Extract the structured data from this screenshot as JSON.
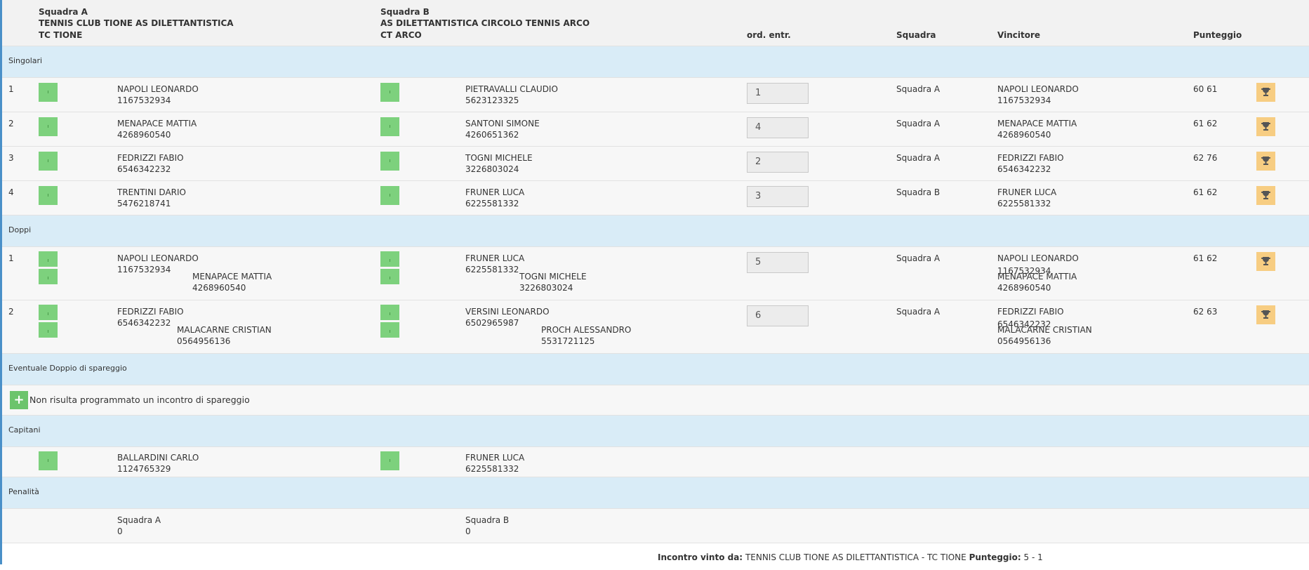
{
  "header": {
    "team_a_label": "Squadra A",
    "team_a_name": "TENNIS CLUB TIONE AS DILETTANTISTICA",
    "team_a_short": "TC TIONE",
    "team_b_label": "Squadra B",
    "team_b_name": "AS DILETTANTISTICA CIRCOLO TENNIS ARCO",
    "team_b_short": "CT ARCO",
    "col_order": "ord. entr.",
    "col_team": "Squadra",
    "col_winner": "Vincitore",
    "col_score": "Punteggio"
  },
  "sections": {
    "singles": "Singolari",
    "doubles": "Doppi",
    "tiebreak": "Eventuale Doppio di spareggio",
    "captains": "Capitani",
    "penalties": "Penalità"
  },
  "singles": [
    {
      "num": "1",
      "a_name": "NAPOLI LEONARDO",
      "a_id": "1167532934",
      "b_name": "PIETRAVALLI CLAUDIO",
      "b_id": "5623123325",
      "order": "1",
      "team": "Squadra A",
      "w_name": "NAPOLI LEONARDO",
      "w_id": "1167532934",
      "score": "60 61"
    },
    {
      "num": "2",
      "a_name": "MENAPACE MATTIA",
      "a_id": "4268960540",
      "b_name": "SANTONI SIMONE",
      "b_id": "4260651362",
      "order": "4",
      "team": "Squadra A",
      "w_name": "MENAPACE MATTIA",
      "w_id": "4268960540",
      "score": "61 62"
    },
    {
      "num": "3",
      "a_name": "FEDRIZZI FABIO",
      "a_id": "6546342232",
      "b_name": "TOGNI MICHELE",
      "b_id": "3226803024",
      "order": "2",
      "team": "Squadra A",
      "w_name": "FEDRIZZI FABIO",
      "w_id": "6546342232",
      "score": "62 76"
    },
    {
      "num": "4",
      "a_name": "TRENTINI DARIO",
      "a_id": "5476218741",
      "b_name": "FRUNER LUCA",
      "b_id": "6225581332",
      "order": "3",
      "team": "Squadra B",
      "w_name": "FRUNER LUCA",
      "w_id": "6225581332",
      "score": "61 62"
    }
  ],
  "doubles": [
    {
      "num": "1",
      "a1_name": "NAPOLI LEONARDO",
      "a1_id": "1167532934",
      "a2_name": "MENAPACE MATTIA",
      "a2_id": "4268960540",
      "b1_name": "FRUNER LUCA",
      "b1_id": "6225581332",
      "b2_name": "TOGNI MICHELE",
      "b2_id": "3226803024",
      "order": "5",
      "team": "Squadra A",
      "w1_name": "NAPOLI LEONARDO",
      "w1_id": "1167532934",
      "w2_name": "MENAPACE MATTIA",
      "w2_id": "4268960540",
      "score": "61 62"
    },
    {
      "num": "2",
      "a1_name": "FEDRIZZI FABIO",
      "a1_id": "6546342232",
      "a2_name": "MALACARNE CRISTIAN",
      "a2_id": "0564956136",
      "b1_name": "VERSINI LEONARDO",
      "b1_id": "6502965987",
      "b2_name": "PROCH ALESSANDRO",
      "b2_id": "5531721125",
      "order": "6",
      "team": "Squadra A",
      "w1_name": "FEDRIZZI FABIO",
      "w1_id": "6546342232",
      "w2_name": "MALACARNE CRISTIAN",
      "w2_id": "0564956136",
      "score": "62 63"
    }
  ],
  "tiebreak": {
    "message": "Non risulta programmato un incontro di spareggio",
    "add_icon": "plus-icon"
  },
  "captains": {
    "a_name": "BALLARDINI CARLO",
    "a_id": "1124765329",
    "b_name": "FRUNER LUCA",
    "b_id": "6225581332"
  },
  "penalties": {
    "a_label": "Squadra A",
    "a_value": "0",
    "b_label": "Squadra B",
    "b_value": "0"
  },
  "footer": {
    "won_label": "Incontro vinto da:",
    "winner": "TENNIS CLUB TIONE AS DILETTANTISTICA - TC TIONE",
    "score_label": "Punteggio:",
    "score": "5 - 1"
  },
  "colors": {
    "section_bg": "#d9ecf7",
    "row_bg": "#f7f7f7",
    "header_bg": "#f2f2f2",
    "player_box": "#7dd17d",
    "trophy_box": "#f7cd82",
    "plus_btn": "#6cc46c"
  }
}
